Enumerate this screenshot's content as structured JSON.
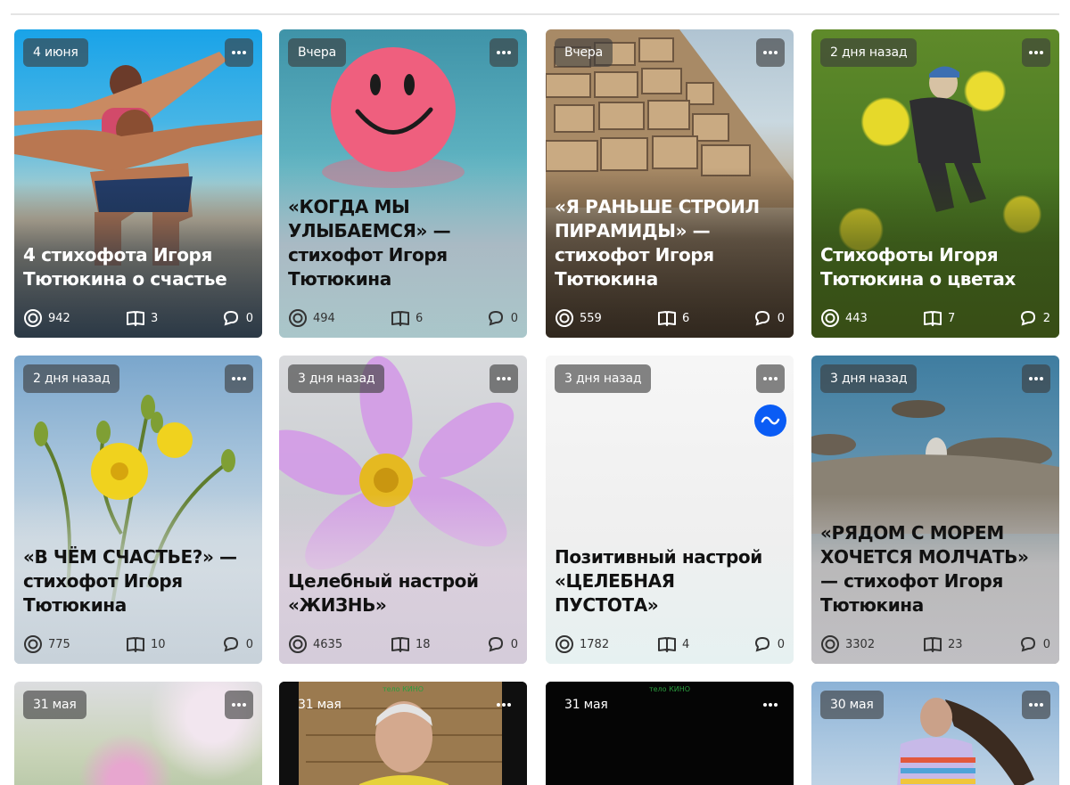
{
  "row1": [
    {
      "badge": "4 июня",
      "title": "4 стихофота Игоря Тютюкина о счастье",
      "views": "942",
      "reads": "3",
      "comments": "0"
    },
    {
      "badge": "Вчера",
      "title": "«КОГДА МЫ УЛЫБАЕМСЯ» — стихофот Игоря Тютюкина",
      "views": "494",
      "reads": "6",
      "comments": "0"
    },
    {
      "badge": "Вчера",
      "title": "«Я РАНЬШЕ СТРОИЛ ПИРАМИДЫ» — стихофот Игоря Тютюкина",
      "views": "559",
      "reads": "6",
      "comments": "0"
    },
    {
      "badge": "2 дня назад",
      "title": "Стихофоты Игоря Тютюкина о цветах",
      "views": "443",
      "reads": "7",
      "comments": "2"
    }
  ],
  "row2": [
    {
      "badge": "2 дня назад",
      "title": "«В ЧЁМ СЧАСТЬЕ?» — стихофот Игоря Тютюкина",
      "views": "775",
      "reads": "10",
      "comments": "0"
    },
    {
      "badge": "3 дня назад",
      "title": "Целебный настрой «ЖИЗНЬ»",
      "views": "4635",
      "reads": "18",
      "comments": "0"
    },
    {
      "badge": "3 дня назад",
      "title": "Позитивный настрой «ЦЕЛЕБНАЯ ПУСТОТА»",
      "views": "1782",
      "reads": "4",
      "comments": "0"
    },
    {
      "badge": "3 дня назад",
      "title": "«РЯДОМ С МОРЕМ ХОЧЕТСЯ МОЛЧАТЬ» — стихофот Игоря Тютюкина",
      "views": "3302",
      "reads": "23",
      "comments": "0"
    }
  ],
  "row3": [
    {
      "badge": "31 мая"
    },
    {
      "badge": "31 мая",
      "sign": "тело КИНО"
    },
    {
      "badge": "31 мая",
      "sign": "тело КИНО"
    },
    {
      "badge": "30 мая"
    }
  ],
  "icons": {
    "views": "eye-circle-icon",
    "reads": "open-book-icon",
    "comments": "speech-bubble-icon",
    "more": "ellipsis-icon",
    "live": "wave-icon"
  },
  "colors": {
    "badge_bg": "#3c3c3c",
    "live_accent": "#0a5cf5",
    "page_bg": "#ffffff"
  }
}
